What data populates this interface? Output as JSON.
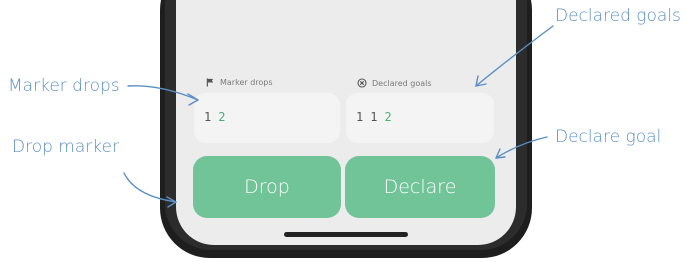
{
  "annotations": {
    "declared_goals": "Declared goals",
    "marker_drops": "Marker drops",
    "drop_marker": "Drop marker",
    "declare_goal": "Declare goal"
  },
  "screen": {
    "marker_drops_label": "Marker drops",
    "marker_drops_icon": "flag-icon",
    "marker_drops_values": [
      "1",
      "2"
    ],
    "declared_goals_label": "Declared goals",
    "declared_goals_icon": "circle-x-icon",
    "declared_goals_values": [
      "1",
      "1",
      "2"
    ],
    "drop_button": "Drop",
    "declare_button": "Declare"
  },
  "colors": {
    "annotation": "#5b8fc4",
    "button": "#70c497",
    "highlight_value": "#4caf7a"
  }
}
